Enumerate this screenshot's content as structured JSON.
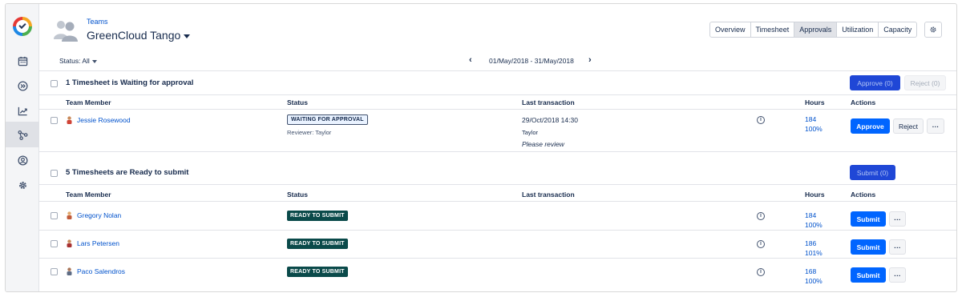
{
  "header": {
    "breadcrumb": "Teams",
    "team_name": "GreenCloud Tango"
  },
  "tabs": [
    {
      "label": "Overview",
      "active": false
    },
    {
      "label": "Timesheet",
      "active": false
    },
    {
      "label": "Approvals",
      "active": true
    },
    {
      "label": "Utilization",
      "active": false
    },
    {
      "label": "Capacity",
      "active": false
    }
  ],
  "rail_icons": [
    "calendar-icon",
    "forward-circle-icon",
    "trend-chart-icon",
    "hierarchy-icon",
    "user-circle-icon",
    "gear-icon"
  ],
  "filter": {
    "status_label": "Status: All",
    "date_range": "01/May/2018 - 31/May/2018"
  },
  "approval_section": {
    "title": "1 Timesheet is Waiting for approval",
    "approve_all_label": "Approve (0)",
    "reject_all_label": "Reject (0)",
    "columns": [
      "Team Member",
      "Status",
      "Last transaction",
      "Hours",
      "Actions"
    ],
    "rows": [
      {
        "member": "Jessie Rosewood",
        "status": "WAITING FOR APPROVAL",
        "reviewer": "Reviewer: Taylor",
        "txn_date": "29/Oct/2018 14:30",
        "txn_user": "Taylor",
        "txn_note": "Please review",
        "info": "i",
        "hours": "184",
        "percent": "100%",
        "approve_label": "Approve",
        "reject_label": "Reject",
        "more_label": "···"
      }
    ]
  },
  "submit_section": {
    "title": "5 Timesheets are Ready to submit",
    "submit_all_label": "Submit (0)",
    "columns": [
      "Team Member",
      "Status",
      "Last transaction",
      "Hours",
      "Actions"
    ],
    "rows": [
      {
        "member": "Gregory Nolan",
        "status": "READY TO SUBMIT",
        "info": "i",
        "hours": "184",
        "percent": "100%",
        "submit_label": "Submit",
        "more_label": "···"
      },
      {
        "member": "Lars Petersen",
        "status": "READY TO SUBMIT",
        "info": "i",
        "hours": "186",
        "percent": "101%",
        "submit_label": "Submit",
        "more_label": "···"
      },
      {
        "member": "Paco Salendros",
        "status": "READY TO SUBMIT",
        "info": "i",
        "hours": "168",
        "percent": "100%",
        "submit_label": "Submit",
        "more_label": "···"
      }
    ]
  },
  "colors": {
    "accent": "#0052cc",
    "primary_button": "#0065ff",
    "ready_badge": "#0a4a4a"
  }
}
